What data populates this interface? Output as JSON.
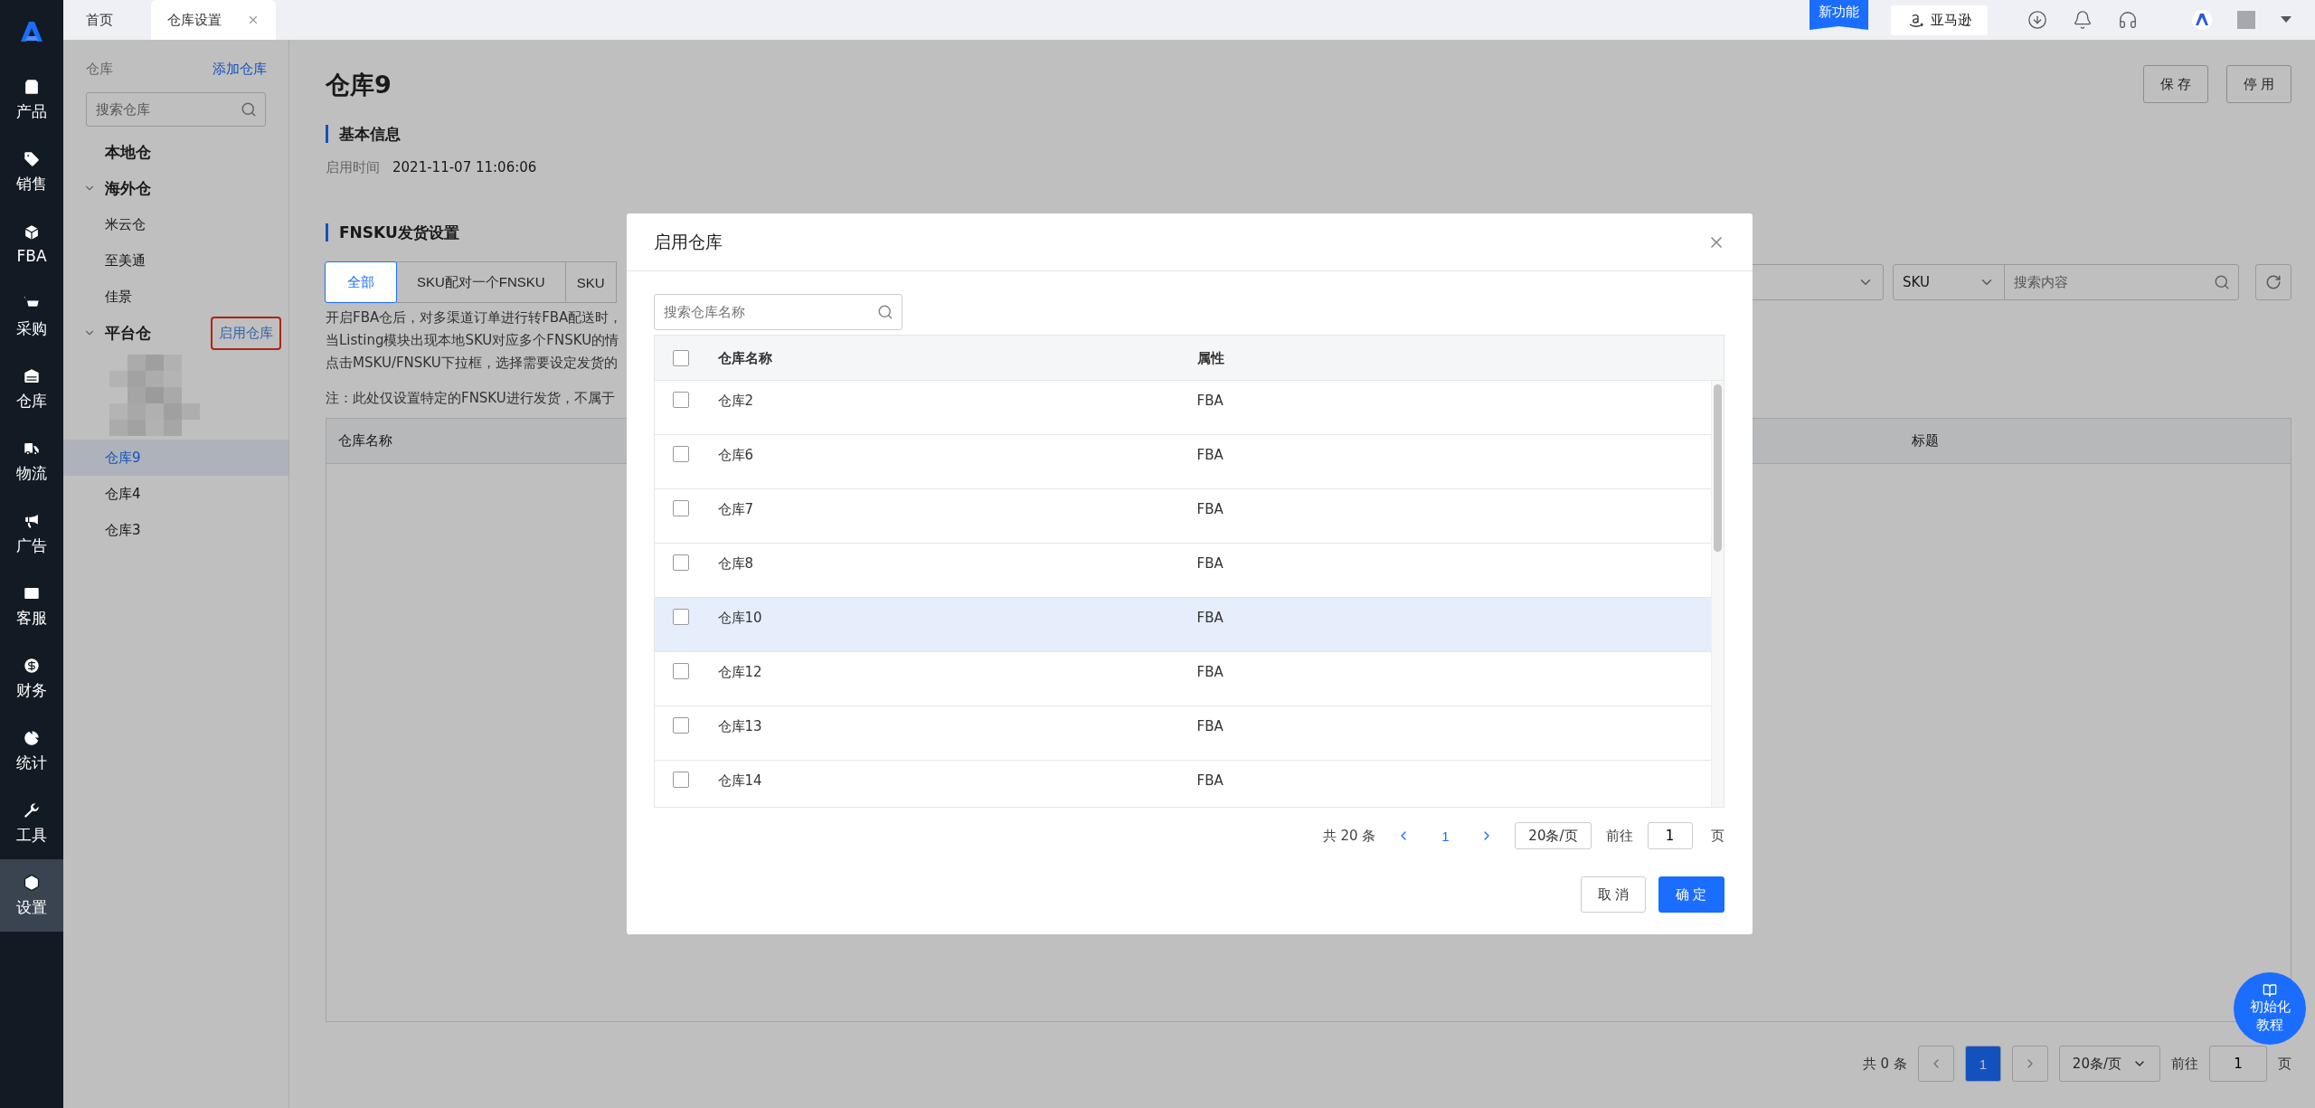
{
  "nav": {
    "items": [
      {
        "label": "产品",
        "selected": false
      },
      {
        "label": "销售",
        "selected": false
      },
      {
        "label": "FBA",
        "selected": false
      },
      {
        "label": "采购",
        "selected": false
      },
      {
        "label": "仓库",
        "selected": false
      },
      {
        "label": "物流",
        "selected": false
      },
      {
        "label": "广告",
        "selected": false
      },
      {
        "label": "客服",
        "selected": false
      },
      {
        "label": "财务",
        "selected": false
      },
      {
        "label": "统计",
        "selected": false
      },
      {
        "label": "工具",
        "selected": false
      },
      {
        "label": "设置",
        "selected": true
      }
    ]
  },
  "top_tabs": [
    {
      "label": "首页",
      "selected": false,
      "closable": false
    },
    {
      "label": "仓库设置",
      "selected": true,
      "closable": true
    }
  ],
  "header": {
    "new_feature": "新功能",
    "marketplace": "亚马逊"
  },
  "warehouse_sidebar": {
    "title": "仓库",
    "add_link": "添加仓库",
    "search": {
      "placeholder": "搜索仓库"
    },
    "groups": [
      {
        "label": "本地仓"
      },
      {
        "label": "海外仓",
        "expanded": true,
        "children": [
          {
            "kind": "item",
            "label": "米云仓",
            "selected": false
          },
          {
            "kind": "item",
            "label": "至美通",
            "selected": false
          },
          {
            "kind": "item",
            "label": "佳景",
            "selected": false
          }
        ]
      },
      {
        "label": "平台仓",
        "expanded": true,
        "action": "启用仓库",
        "action_highlighted": true,
        "children": [
          {
            "kind": "redacted"
          },
          {
            "kind": "item",
            "label": "仓库9",
            "selected": true
          },
          {
            "kind": "item",
            "label": "仓库4",
            "selected": false
          },
          {
            "kind": "item",
            "label": "仓库3",
            "selected": false
          }
        ]
      }
    ]
  },
  "page": {
    "title": "仓库9",
    "buttons": [
      "保 存",
      "停 用"
    ],
    "basic_info": {
      "heading": "基本信息",
      "fields": [
        {
          "label": "启用时间",
          "value": "2021-11-07 11:06:06"
        }
      ]
    },
    "fnsku": {
      "heading": "FNSKU发货设置",
      "tabs": [
        {
          "label": "全部",
          "selected": true
        },
        {
          "label": "SKU配对一个FNSKU",
          "selected": false
        },
        {
          "label": "SKU",
          "selected": false
        }
      ],
      "filters": {
        "field_select": "SKU",
        "search_placeholder": "搜索内容"
      },
      "notes": [
        "开启FBA仓后，对多渠道订单进行转FBA配送时，",
        "当Listing模块出现本地SKU对应多个FNSKU的情",
        "点击MSKU/FNSKU下拉框，选择需要设定发货的"
      ],
      "footnote": "注：此处仅设置特定的FNSKU进行发货，不属于",
      "table": {
        "columns": [
          "仓库名称",
          "标题"
        ]
      },
      "pagination": {
        "total": "共 0 条",
        "page": "1",
        "page_size": "20条/页",
        "goto": "前往",
        "goto_value": "1",
        "unit": "页"
      }
    }
  },
  "help_button": "初始化教程",
  "modal": {
    "title": "启用仓库",
    "search": {
      "placeholder": "搜索仓库名称"
    },
    "select_all": false,
    "columns": [
      "仓库名称",
      "属性"
    ],
    "rows": [
      {
        "name": "仓库2",
        "type": "FBA",
        "checked": false,
        "highlighted": false
      },
      {
        "name": "仓库6",
        "type": "FBA",
        "checked": false,
        "highlighted": false
      },
      {
        "name": "仓库7",
        "type": "FBA",
        "checked": false,
        "highlighted": false
      },
      {
        "name": "仓库8",
        "type": "FBA",
        "checked": false,
        "highlighted": false
      },
      {
        "name": "仓库10",
        "type": "FBA",
        "checked": false,
        "highlighted": true
      },
      {
        "name": "仓库12",
        "type": "FBA",
        "checked": false,
        "highlighted": false
      },
      {
        "name": "仓库13",
        "type": "FBA",
        "checked": false,
        "highlighted": false
      },
      {
        "name": "仓库14",
        "type": "FBA",
        "checked": false,
        "highlighted": false
      }
    ],
    "pagination": {
      "total": "共 20 条",
      "page": "1",
      "page_size": "20条/页",
      "goto": "前往",
      "goto_value": "1",
      "unit": "页"
    },
    "buttons": [
      {
        "label": "取 消",
        "kind": "secondary"
      },
      {
        "label": "确 定",
        "kind": "primary"
      }
    ]
  }
}
